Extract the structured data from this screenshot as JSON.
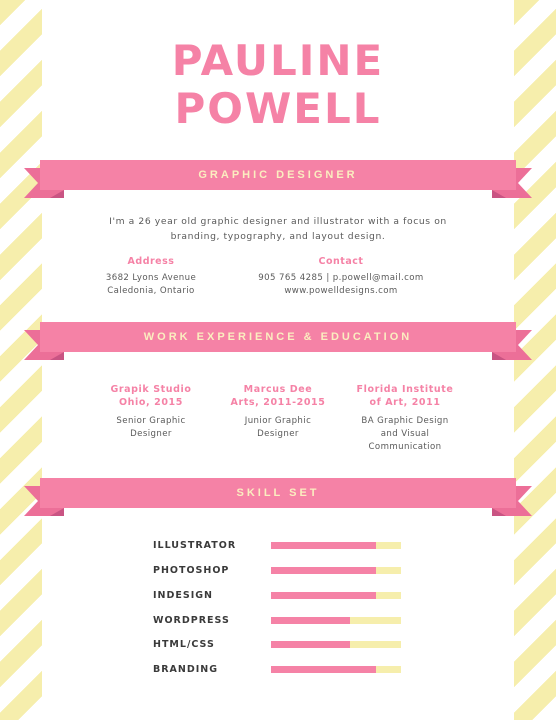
{
  "header": {
    "first_name": "PAULINE",
    "last_name": "POWELL"
  },
  "sections": {
    "title": "GRAPHIC DESIGNER",
    "experience": "WORK EXPERIENCE & EDUCATION",
    "skills": "SKILL SET"
  },
  "intro": {
    "line1": "I'm a 26 year old graphic designer and illustrator with a focus on",
    "line2": "branding, typography, and layout design."
  },
  "address": {
    "label": "Address",
    "line1": "3682 Lyons Avenue",
    "line2": "Caledonia, Ontario"
  },
  "contact": {
    "label": "Contact",
    "line1": "905 765 4285 | p.powell@mail.com",
    "line2": "www.powelldesigns.com"
  },
  "experience": [
    {
      "title_line1": "Grapik Studio",
      "title_line2": "Ohio, 2015",
      "desc_line1": "Senior Graphic",
      "desc_line2": "Designer",
      "desc_line3": ""
    },
    {
      "title_line1": "Marcus Dee",
      "title_line2": "Arts, 2011-2015",
      "desc_line1": "Junior Graphic",
      "desc_line2": "Designer",
      "desc_line3": ""
    },
    {
      "title_line1": "Florida Institute",
      "title_line2": "of Art, 2011",
      "desc_line1": "BA Graphic Design",
      "desc_line2": "and Visual",
      "desc_line3": "Communication"
    }
  ],
  "skills": [
    {
      "name": "ILLUSTRATOR",
      "level": 0.81
    },
    {
      "name": "PHOTOSHOP",
      "level": 0.81
    },
    {
      "name": "INDESIGN",
      "level": 0.81
    },
    {
      "name": "WORDPRESS",
      "level": 0.61
    },
    {
      "name": "HTML/CSS",
      "level": 0.61
    },
    {
      "name": "BRANDING",
      "level": 0.81
    }
  ],
  "colors": {
    "accent": "#f582a6",
    "stripe": "#f6eeac",
    "banner_text": "#fbeec0"
  }
}
